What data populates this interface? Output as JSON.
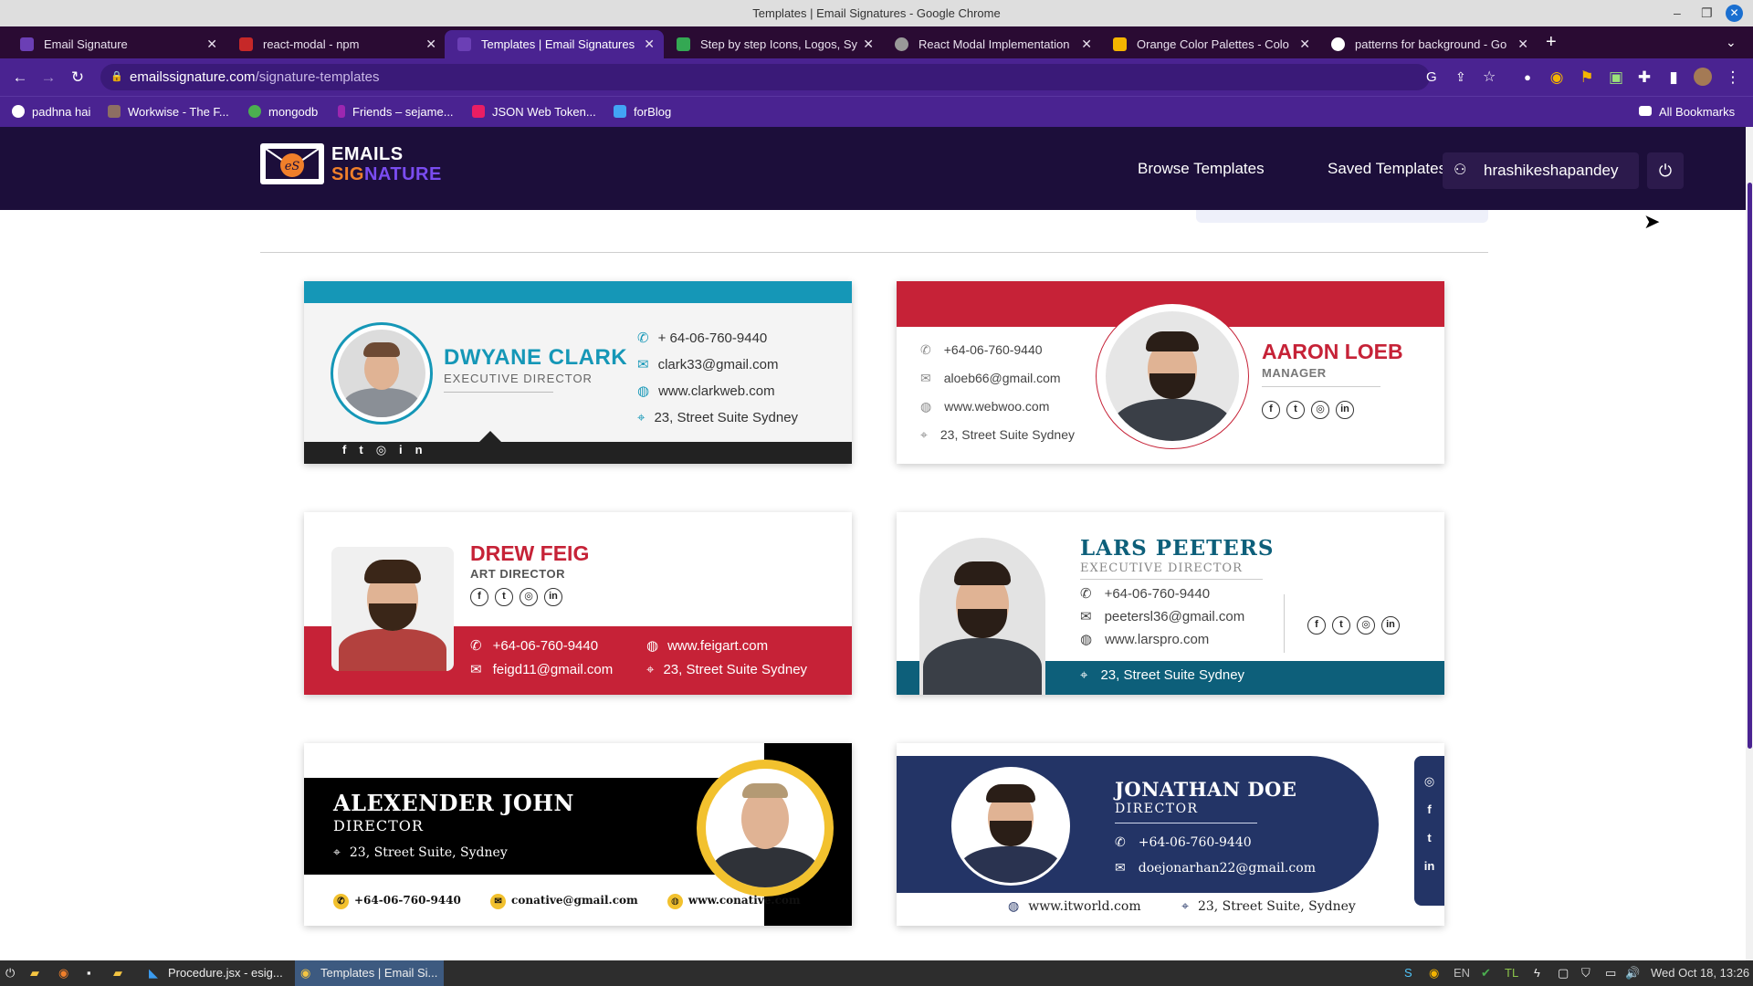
{
  "window": {
    "title": "Templates | Email Signatures - Google Chrome"
  },
  "tabs": [
    {
      "label": "Email Signature",
      "color": "#6b3fb5"
    },
    {
      "label": "react-modal - npm",
      "color": "#c62828"
    },
    {
      "label": "Templates | Email Signatures",
      "color": "#6b3fb5"
    },
    {
      "label": "Step by step Icons, Logos, Sy",
      "color": "#34a853"
    },
    {
      "label": "React Modal Implementation",
      "color": "#999999"
    },
    {
      "label": "Orange Color Palettes - Colo",
      "color": "#f4b400"
    },
    {
      "label": "patterns for background - Go",
      "color": "#ffffff"
    }
  ],
  "address": {
    "domain": "emailssignature.com",
    "path": "/signature-templates"
  },
  "bookmarks": [
    {
      "label": "padhna hai",
      "color": "#ffffff"
    },
    {
      "label": "Workwise - The F...",
      "color": "#8d6e63"
    },
    {
      "label": "mongodb",
      "color": "#4caf50"
    },
    {
      "label": "Friends – sejame...",
      "color": "#9c27b0"
    },
    {
      "label": "JSON Web Token...",
      "color": "#e91e63"
    },
    {
      "label": "forBlog",
      "color": "#42a5f5"
    }
  ],
  "all_bookmarks": "All Bookmarks",
  "site": {
    "logo_line1": "EMAILS",
    "logo_line2a": "SIG",
    "logo_line2b": "NATURE",
    "nav": {
      "browse": "Browse Templates",
      "saved": "Saved Templates"
    },
    "user": "hrashikeshapandey"
  },
  "cards": {
    "dwyane": {
      "name": "DWYANE CLARK",
      "title": "EXECUTIVE DIRECTOR",
      "phone": "+ 64-06-760-9440",
      "email": "clark33@gmail.com",
      "web": "www.clarkweb.com",
      "addr": "23, Street Suite Sydney",
      "accent": "#1597b7"
    },
    "aaron": {
      "name": "AARON LOEB",
      "title": "MANAGER",
      "phone": "+64-06-760-9440",
      "email": "aloeb66@gmail.com",
      "web": "www.webwoo.com",
      "addr": "23, Street Suite Sydney",
      "accent": "#c62237"
    },
    "drew": {
      "name": "DREW FEIG",
      "title": "ART DIRECTOR",
      "phone": "+64-06-760-9440",
      "email": "feigd11@gmail.com",
      "web": "www.feigart.com",
      "addr": "23, Street Suite Sydney",
      "accent": "#c62237"
    },
    "lars": {
      "name": "LARS PEETERS",
      "title": "EXECUTIVE DIRECTOR",
      "phone": "+64-06-760-9440",
      "email": "peetersl36@gmail.com",
      "web": "www.larspro.com",
      "addr": "23, Street Suite Sydney",
      "accent": "#0d5f7a"
    },
    "alex": {
      "name": "ALEXENDER JOHN",
      "title": "DIRECTOR",
      "addr": "23, Street Suite, Sydney",
      "phone": "+64-06-760-9440",
      "email": "conative@gmail.com",
      "web": "www.conative.com",
      "accent": "#f2c12e"
    },
    "jon": {
      "name": "JONATHAN DOE",
      "title": "DIRECTOR",
      "phone": "+64-06-760-9440",
      "email": "doejonarhan22@gmail.com",
      "web": "www.itworld.com",
      "addr": "23, Street Suite, Sydney",
      "accent": "#233466"
    }
  },
  "taskbar": {
    "items": [
      "Procedure.jsx - esig...",
      "Templates | Email Si..."
    ],
    "lang": "EN",
    "clock": "Wed Oct 18, 13:26"
  }
}
